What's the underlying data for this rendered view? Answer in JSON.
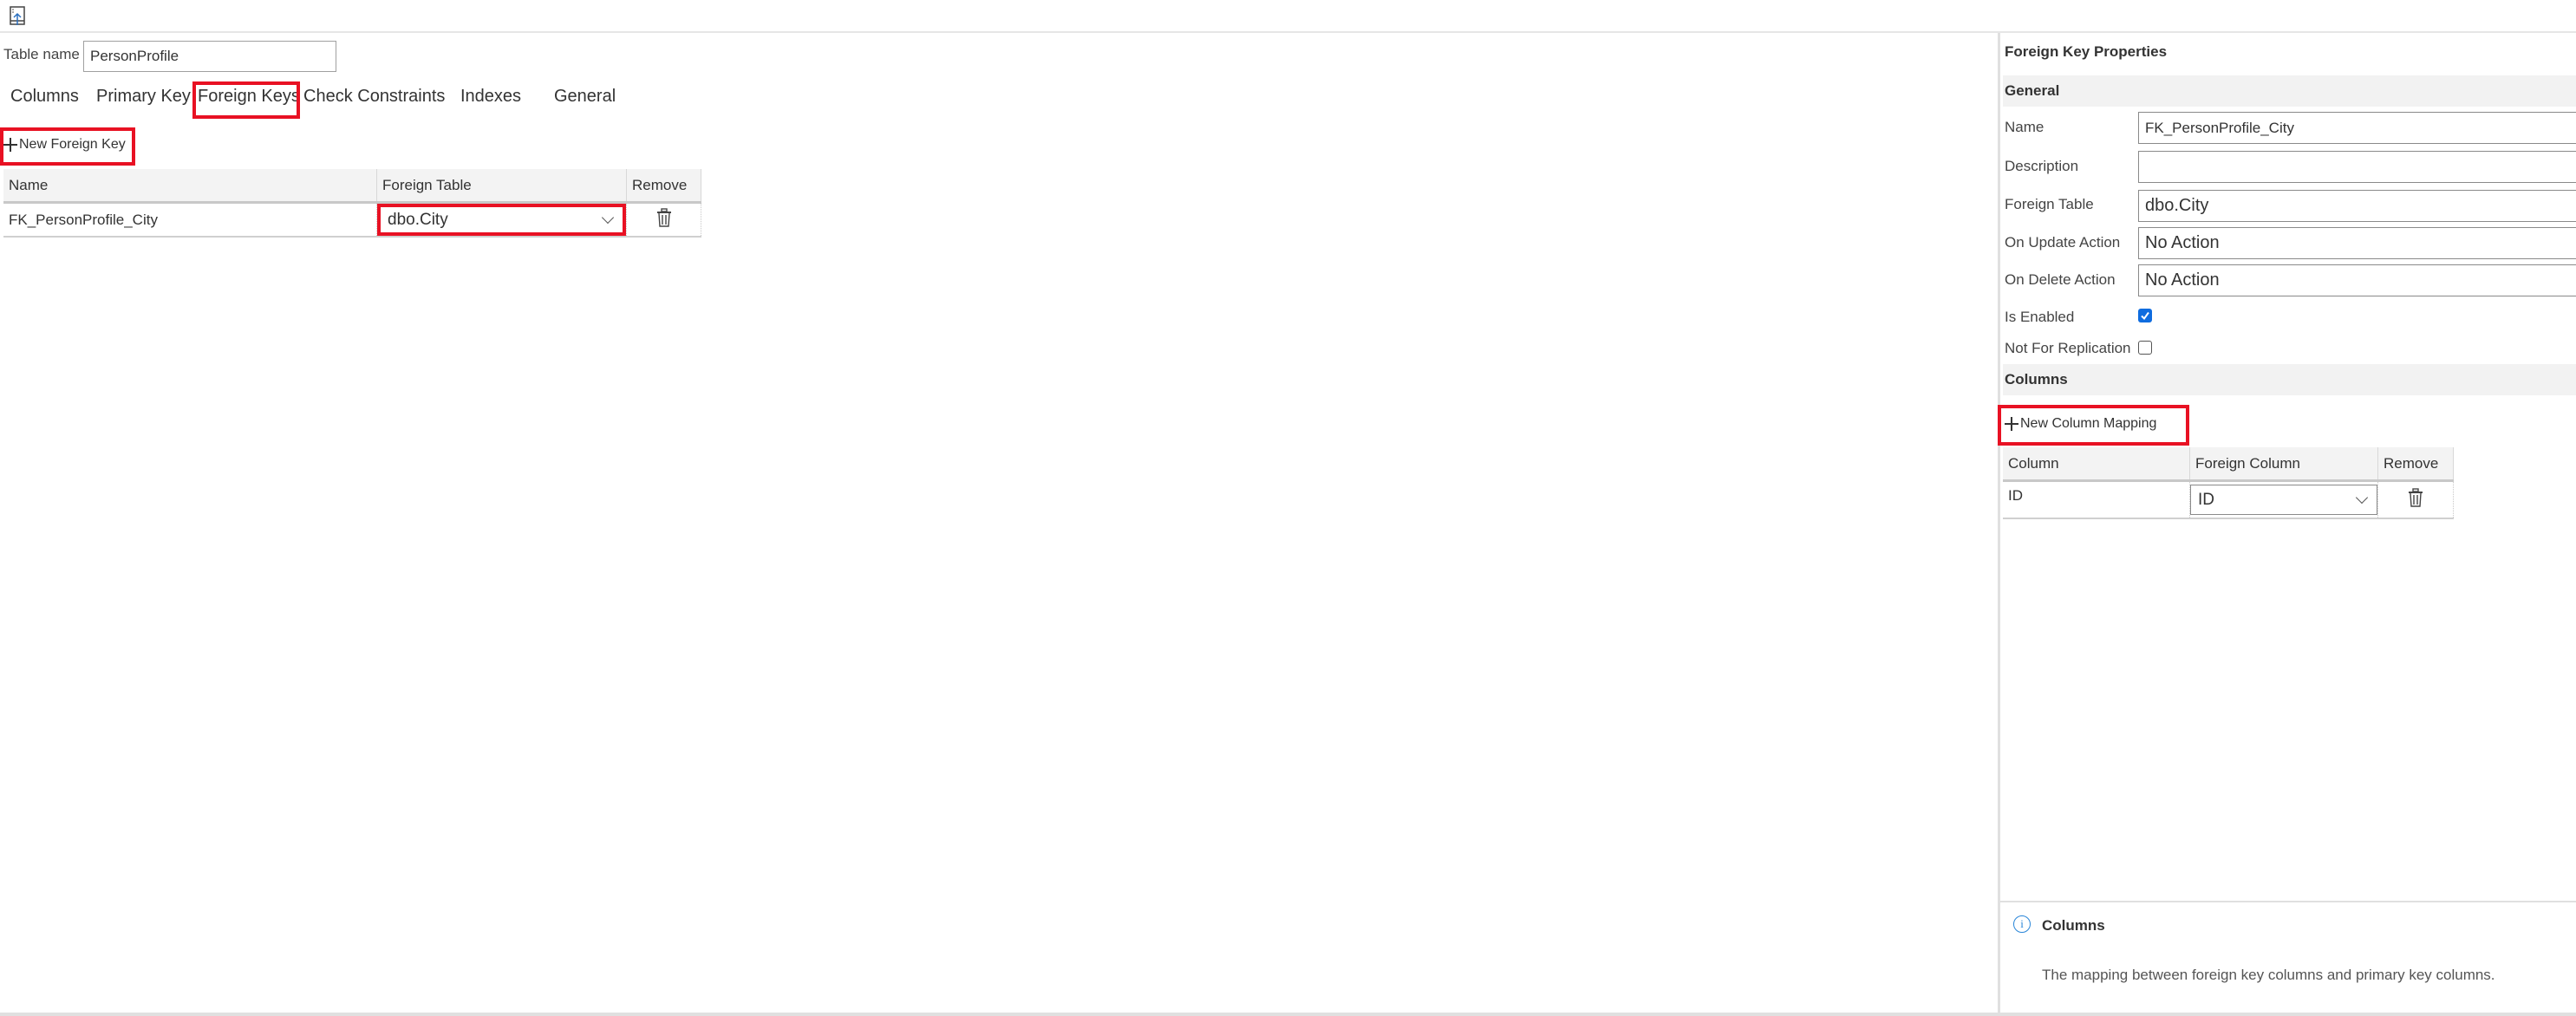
{
  "toolbar": {
    "icon": "publish-icon"
  },
  "table_name": {
    "label": "Table name",
    "value": "PersonProfile"
  },
  "tabs": [
    {
      "label": "Columns",
      "active": false
    },
    {
      "label": "Primary Key",
      "active": false
    },
    {
      "label": "Foreign Keys",
      "active": true
    },
    {
      "label": "Check Constraints",
      "active": false
    },
    {
      "label": "Indexes",
      "active": false
    },
    {
      "label": "General",
      "active": false
    }
  ],
  "foreign_keys": {
    "new_button": "New Foreign Key",
    "columns": [
      "Name",
      "Foreign Table",
      "Remove"
    ],
    "rows": [
      {
        "name": "FK_PersonProfile_City",
        "foreign_table": "dbo.City"
      }
    ]
  },
  "properties": {
    "title": "Foreign Key Properties",
    "general_section": "General",
    "fields": {
      "name": {
        "label": "Name",
        "value": "FK_PersonProfile_City"
      },
      "description": {
        "label": "Description",
        "value": ""
      },
      "foreign_table": {
        "label": "Foreign Table",
        "value": "dbo.City"
      },
      "on_update": {
        "label": "On Update Action",
        "value": "No Action"
      },
      "on_delete": {
        "label": "On Delete Action",
        "value": "No Action"
      },
      "is_enabled": {
        "label": "Is Enabled",
        "checked": true
      },
      "not_for_replication": {
        "label": "Not For Replication",
        "checked": false
      }
    },
    "columns_section": "Columns",
    "new_mapping_button": "New Column Mapping",
    "mapping_columns": [
      "Column",
      "Foreign Column",
      "Remove"
    ],
    "mappings": [
      {
        "column": "ID",
        "foreign_column": "ID"
      }
    ]
  },
  "info": {
    "title": "Columns",
    "description": "The mapping between foreign key columns and primary key columns."
  },
  "colors": {
    "highlight": "#e81123",
    "checkbox": "#0f6cdf",
    "info": "#2a86d8"
  }
}
